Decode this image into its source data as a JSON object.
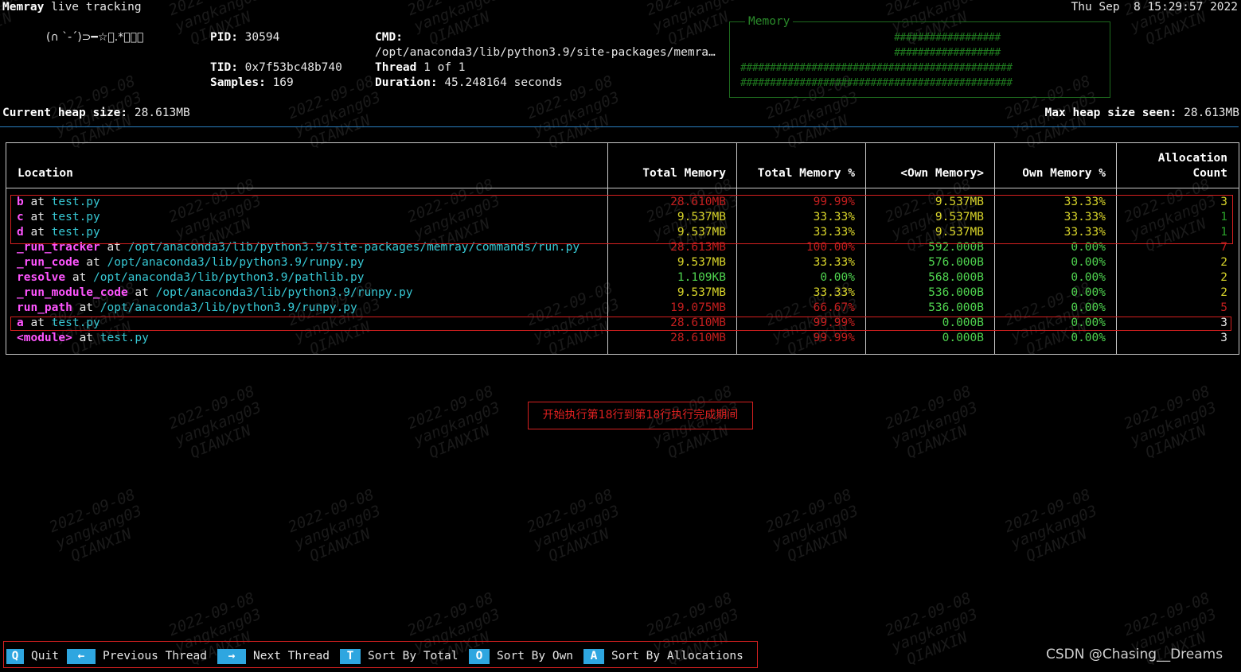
{
  "header": {
    "app_name": "Memray",
    "title_rest": " live tracking",
    "datetime": "Thu Sep  8 15:29:57 2022",
    "face": "(∩ `-´)⊃━☆ﾟ.*･｡ﾟ",
    "pid_label": "PID:",
    "pid": "30594",
    "tid_label": "TID:",
    "tid": "0x7f53bc48b740",
    "samples_label": "Samples:",
    "samples": "169",
    "cmd_label": "CMD:",
    "cmd": "/opt/anaconda3/lib/python3.9/site-packages/memra…",
    "thread_label": "Thread",
    "thread": "1 of 1",
    "duration_label": "Duration:",
    "duration": "45.248164 seconds",
    "current_heap_label": "Current heap size:",
    "current_heap": "28.613MB",
    "max_heap_label": "Max heap size seen:",
    "max_heap": "28.613MB"
  },
  "memory_graph": {
    "title": "Memory",
    "rows": [
      "                          ##################",
      "                          ##################",
      "##############################################",
      "##############################################"
    ]
  },
  "table": {
    "headers": {
      "location": "Location",
      "total_memory": "Total Memory",
      "total_memory_pct": "Total Memory %",
      "own_memory": "<Own Memory>",
      "own_memory_pct": "Own Memory %",
      "alloc_line1": "Allocation",
      "alloc_line2": "Count"
    },
    "rows": [
      {
        "fn": "b",
        "at": " at ",
        "file": "test.py",
        "total": "28.610MB",
        "total_pct": "99.99%",
        "own": "9.537MB",
        "own_pct": "33.33%",
        "count": "3"
      },
      {
        "fn": "c",
        "at": " at ",
        "file": "test.py",
        "total": "9.537MB",
        "total_pct": "33.33%",
        "own": "9.537MB",
        "own_pct": "33.33%",
        "count": "1"
      },
      {
        "fn": "d",
        "at": " at ",
        "file": "test.py",
        "total": "9.537MB",
        "total_pct": "33.33%",
        "own": "9.537MB",
        "own_pct": "33.33%",
        "count": "1"
      },
      {
        "fn": "_run_tracker",
        "at": " at ",
        "file": "/opt/anaconda3/lib/python3.9/site-packages/memray/commands/run.py",
        "total": "28.613MB",
        "total_pct": "100.00%",
        "own": "592.000B",
        "own_pct": "0.00%",
        "count": "7"
      },
      {
        "fn": "_run_code",
        "at": " at ",
        "file": "/opt/anaconda3/lib/python3.9/runpy.py",
        "total": "9.537MB",
        "total_pct": "33.33%",
        "own": "576.000B",
        "own_pct": "0.00%",
        "count": "2"
      },
      {
        "fn": "resolve",
        "at": " at ",
        "file": "/opt/anaconda3/lib/python3.9/pathlib.py",
        "total": "1.109KB",
        "total_pct": "0.00%",
        "own": "568.000B",
        "own_pct": "0.00%",
        "count": "2"
      },
      {
        "fn": "_run_module_code",
        "at": " at ",
        "file": "/opt/anaconda3/lib/python3.9/runpy.py",
        "total": "9.537MB",
        "total_pct": "33.33%",
        "own": "536.000B",
        "own_pct": "0.00%",
        "count": "2"
      },
      {
        "fn": "run_path",
        "at": " at ",
        "file": "/opt/anaconda3/lib/python3.9/runpy.py",
        "total": "19.075MB",
        "total_pct": "66.67%",
        "own": "536.000B",
        "own_pct": "0.00%",
        "count": "5"
      },
      {
        "fn": "a",
        "at": " at ",
        "file": "test.py",
        "total": "28.610MB",
        "total_pct": "99.99%",
        "own": "0.000B",
        "own_pct": "0.00%",
        "count": "3"
      },
      {
        "fn": "<module>",
        "at": " at ",
        "file": "test.py",
        "total": "28.610MB",
        "total_pct": "99.99%",
        "own": "0.000B",
        "own_pct": "0.00%",
        "count": "3"
      }
    ]
  },
  "annotation": "开始执行第18行到第18行执行完成期间",
  "footer": {
    "keys": [
      {
        "key": "Q",
        "label": "Quit"
      },
      {
        "key": "←",
        "label": "Previous Thread"
      },
      {
        "key": "→",
        "label": "Next Thread"
      },
      {
        "key": "T",
        "label": "Sort By Total"
      },
      {
        "key": "O",
        "label": "Sort By Own"
      },
      {
        "key": "A",
        "label": "Sort By Allocations"
      }
    ]
  },
  "watermark": {
    "date": "2022-09-08",
    "user": "yangkang03",
    "org": "QIANXIN"
  },
  "credit": "CSDN @Chasing__Dreams",
  "colors": {
    "background": "#000000",
    "key_bg": "#2ea6e0",
    "highlight_border": "#d42020",
    "function_name": "#ff55ff",
    "file_path": "#37c8d4",
    "graph": "#1f7a1f"
  }
}
